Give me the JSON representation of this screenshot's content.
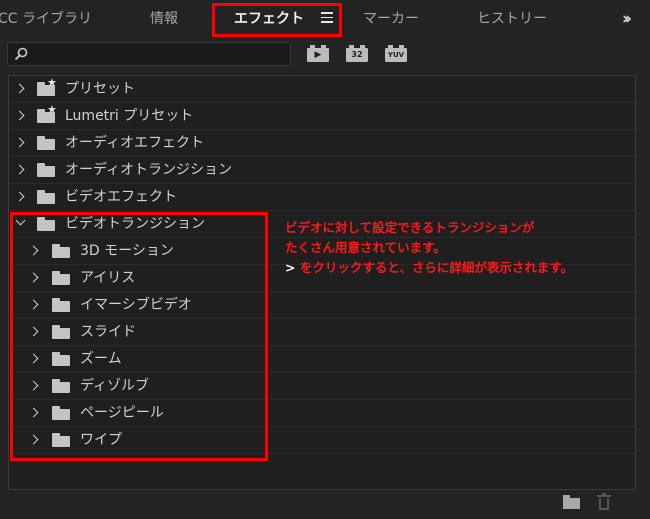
{
  "tabs": [
    {
      "label": "CC ライブラリ"
    },
    {
      "label": "情報"
    },
    {
      "label": "エフェクト"
    },
    {
      "label": "マーカー"
    },
    {
      "label": "ヒストリー"
    }
  ],
  "active_tab": "エフェクト",
  "overflow_icon": "double-chevron-right-icon",
  "search": {
    "value": "",
    "placeholder": ""
  },
  "filters": [
    {
      "name": "accelerated-effects-filter",
      "label": ""
    },
    {
      "name": "32bit-color-filter",
      "label": "32"
    },
    {
      "name": "yuv-effects-filter",
      "label": "YUV"
    }
  ],
  "tree": [
    {
      "label": "プリセット",
      "level": 0,
      "expanded": false,
      "icon": "preset-folder-icon"
    },
    {
      "label": "Lumetri プリセット",
      "level": 0,
      "expanded": false,
      "icon": "preset-folder-icon"
    },
    {
      "label": "オーディオエフェクト",
      "level": 0,
      "expanded": false,
      "icon": "folder-icon"
    },
    {
      "label": "オーディオトランジション",
      "level": 0,
      "expanded": false,
      "icon": "folder-icon"
    },
    {
      "label": "ビデオエフェクト",
      "level": 0,
      "expanded": false,
      "icon": "folder-icon"
    },
    {
      "label": "ビデオトランジション",
      "level": 0,
      "expanded": true,
      "icon": "folder-icon"
    },
    {
      "label": "3D モーション",
      "level": 1,
      "expanded": false,
      "icon": "folder-icon"
    },
    {
      "label": "アイリス",
      "level": 1,
      "expanded": false,
      "icon": "folder-icon"
    },
    {
      "label": "イマーシブビデオ",
      "level": 1,
      "expanded": false,
      "icon": "folder-icon"
    },
    {
      "label": "スライド",
      "level": 1,
      "expanded": false,
      "icon": "folder-icon"
    },
    {
      "label": "ズーム",
      "level": 1,
      "expanded": false,
      "icon": "folder-icon"
    },
    {
      "label": "ディゾルブ",
      "level": 1,
      "expanded": false,
      "icon": "folder-icon"
    },
    {
      "label": "ページピール",
      "level": 1,
      "expanded": false,
      "icon": "folder-icon"
    },
    {
      "label": "ワイプ",
      "level": 1,
      "expanded": false,
      "icon": "folder-icon"
    }
  ],
  "annotation": {
    "line1": "ビデオに対して設定できるトランジションが",
    "line2": "たくさん用意されています。",
    "line3_symbol": ">",
    "line3_text": " をクリックすると、さらに詳細が表示されます。"
  },
  "bottom_icons": [
    "new-bin-icon",
    "trash-icon"
  ],
  "colors": {
    "highlight": "#ff0000",
    "annotation_text": "#ff1a1a",
    "panel_bg": "#232323"
  }
}
